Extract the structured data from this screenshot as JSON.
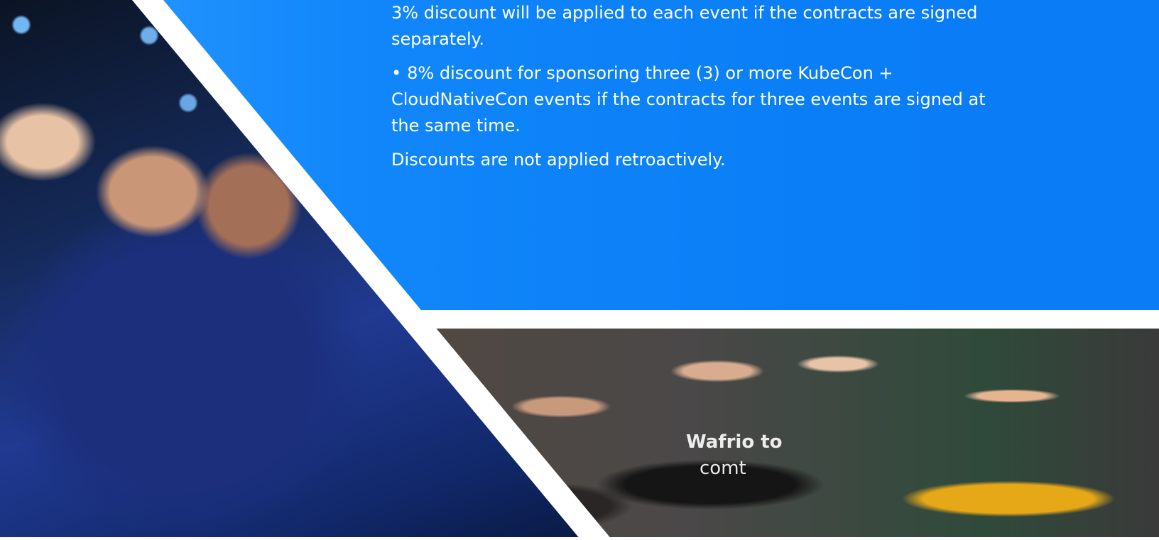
{
  "discounts": {
    "line_partial": "3% discount will be applied to each event if the contracts are signed separately.",
    "bullet_symbol": "•",
    "bullet_text": "8% discount for sponsoring three (3) or more KubeCon + CloudNativeCon events if the contracts for three events are signed at the same time.",
    "note": "Discounts are not applied retroactively."
  },
  "photos": {
    "shirt_text": "Wafrio to",
    "shirt_text_line2": "comt"
  },
  "colors": {
    "panel_blue": "#0a7ef6",
    "text": "#ffffff"
  }
}
